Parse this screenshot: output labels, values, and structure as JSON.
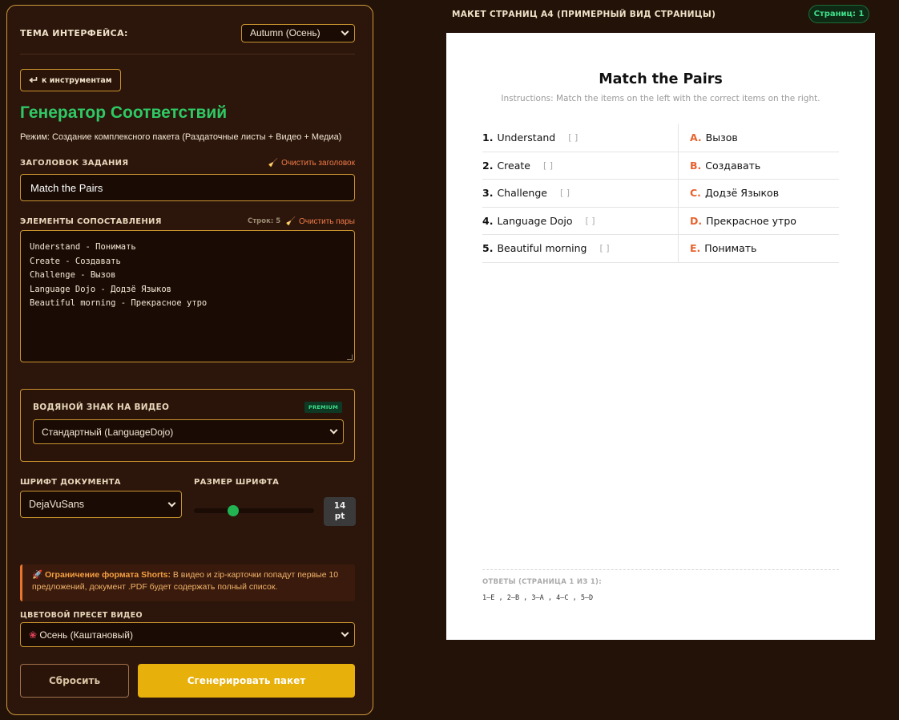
{
  "theme": {
    "label": "ТЕМА ИНТЕРФЕЙСА:",
    "selected": "Autumn (Осень)"
  },
  "back_button": {
    "icon": "return-arrow-icon",
    "label": "к инструментам"
  },
  "app": {
    "title": "Генератор Соответствий",
    "mode": "Режим: Создание комплексного пакета (Раздаточные листы + Видео + Медиа)"
  },
  "task_title": {
    "label": "ЗАГОЛОВОК ЗАДАНИЯ",
    "clear_label": "Очистить заголовок",
    "value": "Match the Pairs"
  },
  "pairs_input": {
    "label": "ЭЛЕМЕНТЫ СОПОСТАВЛЕНИЯ",
    "rows_label": "Строк: 5",
    "clear_label": "Очистить пары",
    "lines": [
      "Understand - Понимать",
      "Create - Создавать",
      "Challenge - Вызов",
      "Language Dojo - Додзё Языков",
      "Beautiful morning - Прекрасное утро"
    ]
  },
  "watermark": {
    "label": "ВОДЯНОЙ ЗНАК НА ВИДЕО",
    "badge": "PREMIUM",
    "selected": "Стандартный (LanguageDojo)"
  },
  "font": {
    "label": "ШРИФТ ДОКУМЕНТА",
    "selected": "DejaVuSans"
  },
  "font_size": {
    "label": "РАЗМЕР ШРИФТА",
    "value": "14",
    "unit": "pt",
    "slider_fraction": 0.31
  },
  "notice": {
    "icon": "rocket-icon",
    "bold": "Ограничение формата Shorts:",
    "text": " В видео и zip-карточки попадут первые 10 предложений, документ .PDF будет содержать полный список."
  },
  "color_preset": {
    "label": "ЦВЕТОВОЙ ПРЕСЕТ ВИДЕО",
    "icon": "maple-leaf-icon",
    "selected": "Осень (Каштановый)"
  },
  "buttons": {
    "reset": "Сбросить",
    "generate": "Сгенерировать пакет"
  },
  "preview": {
    "title": "МАКЕТ СТРАНИЦ А4 (ПРИМЕРНЫЙ ВИД СТРАНИЦЫ)",
    "pages_badge": "Страниц: 1",
    "sheet": {
      "title": "Match the Pairs",
      "instructions": "Instructions: Match the items on the left with the correct items on the right.",
      "left_items": [
        {
          "num": "1.",
          "text": "Understand"
        },
        {
          "num": "2.",
          "text": "Create"
        },
        {
          "num": "3.",
          "text": "Challenge"
        },
        {
          "num": "4.",
          "text": "Language Dojo"
        },
        {
          "num": "5.",
          "text": "Beautiful morning"
        }
      ],
      "bracket": "[   ]",
      "right_items": [
        {
          "letter": "A.",
          "text": "Вызов"
        },
        {
          "letter": "B.",
          "text": "Создавать"
        },
        {
          "letter": "C.",
          "text": "Додзё Языков"
        },
        {
          "letter": "D.",
          "text": "Прекрасное утро"
        },
        {
          "letter": "E.",
          "text": "Понимать"
        }
      ],
      "answers_label": "ОТВЕТЫ (СТРАНИЦА 1 ИЗ 1):",
      "answers": "1–E , 2–B , 3–A , 4–C , 5–D"
    }
  },
  "colors": {
    "accent_green": "#2ec964",
    "border_gold": "#c8922e",
    "generate_yellow": "#e8b00a",
    "letter_orange": "#e8622e"
  }
}
